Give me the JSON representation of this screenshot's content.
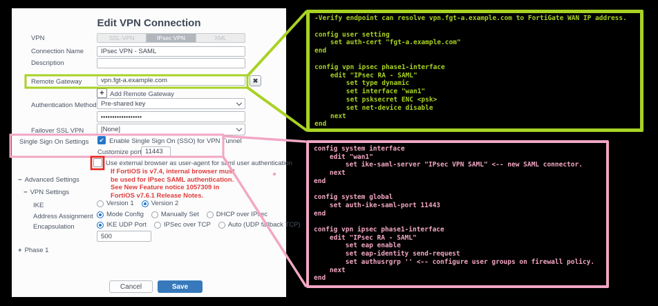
{
  "colors": {
    "green": "#a8d224",
    "pink": "#f2a7c4",
    "red": "#e8251f",
    "warning_red": "#e03c3c",
    "accent_blue": "#2277c8",
    "save_blue": "#3779bb"
  },
  "icons": {
    "remove": "✖",
    "add": "+",
    "collapse": "−",
    "expand": "+",
    "check": "✔"
  },
  "dialog": {
    "title": "Edit VPN Connection",
    "vpn_label": "VPN",
    "tabs": [
      "SSL-VPN",
      "IPsec VPN",
      "XML"
    ],
    "active_tab": "IPsec VPN",
    "fields": {
      "connection_name": {
        "label": "Connection Name",
        "value": "IPsec VPN - SAML"
      },
      "description": {
        "label": "Description",
        "value": ""
      },
      "remote_gateway": {
        "label": "Remote Gateway",
        "value": "vpn.fgt-a.example.com"
      },
      "add_remote_gateway_label": "Add Remote Gateway",
      "authentication_method": {
        "label": "Authentication Method",
        "value": "Pre-shared key"
      },
      "password_masked": "••••••••••••••••••",
      "failover": {
        "label": "Failover SSL VPN",
        "value": "[None]"
      }
    },
    "sso": {
      "label": "Single Sign On Settings",
      "enable_label": "Enable Single Sign On (SSO) for VPN Tunnel",
      "enable_checked": true,
      "customize_port_label": "Customize port",
      "customize_port_value": "11443",
      "external_browser_label": "Use external browser as user-agent for saml user authentication",
      "external_browser_checked": false,
      "warning_lines": [
        "If FortiOS is v7.4, internal browser must",
        "be used for IPsec SAML authentication.",
        "See New Feature notice 1057309 in",
        "FortiOS v7.6.1 Release Notes."
      ]
    },
    "advanced": {
      "advanced_settings_label": "Advanced Settings",
      "vpn_settings_label": "VPN Settings",
      "ike": {
        "label": "IKE",
        "options": [
          "Version 1",
          "Version 2"
        ],
        "selected": "Version 2"
      },
      "address_assignment": {
        "label": "Address Assignment",
        "options": [
          "Mode Config",
          "Manually Set",
          "DHCP over IPsec"
        ],
        "selected": "Mode Config"
      },
      "encapsulation": {
        "label": "Encapsulation",
        "options": [
          "IKE UDP Port",
          "IPSec over TCP",
          "Auto (UDP fallback TCP)"
        ],
        "selected": "IKE UDP Port"
      },
      "port_value": "500",
      "phase1_label": "Phase 1"
    },
    "buttons": {
      "cancel": "Cancel",
      "save": "Save"
    }
  },
  "green_callout": {
    "code": "-Verify endpoint can resolve vpn.fgt-a.example.com to FortiGate WAN IP address.\n\nconfig user setting\n    set auth-cert \"fgt-a.example.com\"\nend\n\nconfig vpn ipsec phase1-interface\n    edit \"IPsec RA - SAML\"\n        set type dynamic\n        set interface \"wan1\"\n        set psksecret ENC <psk>\n        set net-device disable\n    next\nend"
  },
  "pink_callout": {
    "code": "config system interface\n    edit \"wan1\"\n        set ike-saml-server \"IPsec VPN SAML\" <-- new SAML connector.\n    next\nend\n\nconfig system global\n    set auth-ike-saml-port 11443\nend\n\nconfig vpn ipsec phase1-interface\n    edit \"IPsec RA - SAML\"\n        set eap enable\n        set eap-identity send-request\n        set authusrgrp '' <-- configure user groups on firewall policy.\n    next\nend"
  }
}
